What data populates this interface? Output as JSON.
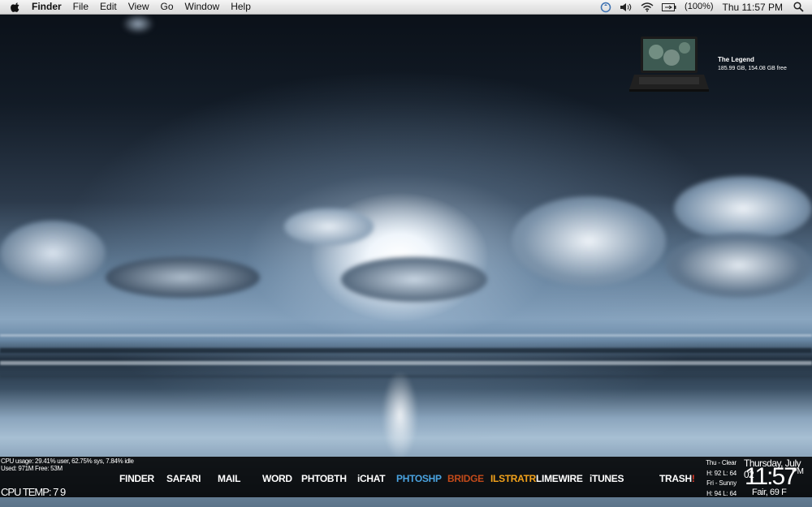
{
  "menubar": {
    "app_name": "Finder",
    "menus": [
      "File",
      "Edit",
      "View",
      "Go",
      "Window"
    ],
    "help": "Help",
    "battery": "(100%)",
    "clock": "Thu 11:57 PM"
  },
  "drive": {
    "name": "The Legend",
    "info": "185.99 GB, 154.08 GB free"
  },
  "system": {
    "cpu_usage": "CPU usage: 29.41% user, 62.75% sys, 7.84% idle",
    "memory": "Used: 971M Free: 53M",
    "cpu_temp": "CPU TEMP: 7 9"
  },
  "dock": {
    "finder": "FINDER",
    "safari": "SAFARI",
    "mail": "MAIL",
    "word": "WORD",
    "photobooth": "PHTOBTH",
    "ichat": "iCHAT",
    "photoshop": "PHTOSHP",
    "bridge": "BRIDGE",
    "illustrator": "ILSTRATR",
    "limewire": "LIMEWIRE",
    "itunes": "iTUNES",
    "trash": "TRASH",
    "trash_suffix": "!"
  },
  "colors": {
    "photoshop": "#4aa3e0",
    "bridge": "#c24a1a",
    "illustrator": "#f2a21b",
    "trash_suffix": "#e03b2a"
  },
  "weather": {
    "today_label": "Thu - Clear",
    "today_temps": "H: 92 L: 64",
    "tomorrow_label": "Fri - Sunny",
    "tomorrow_temps": "H: 94 L: 64",
    "date": "Thursday, July 02",
    "time": "11:57",
    "ampm": "PM",
    "current": "Fair, 69 F"
  }
}
